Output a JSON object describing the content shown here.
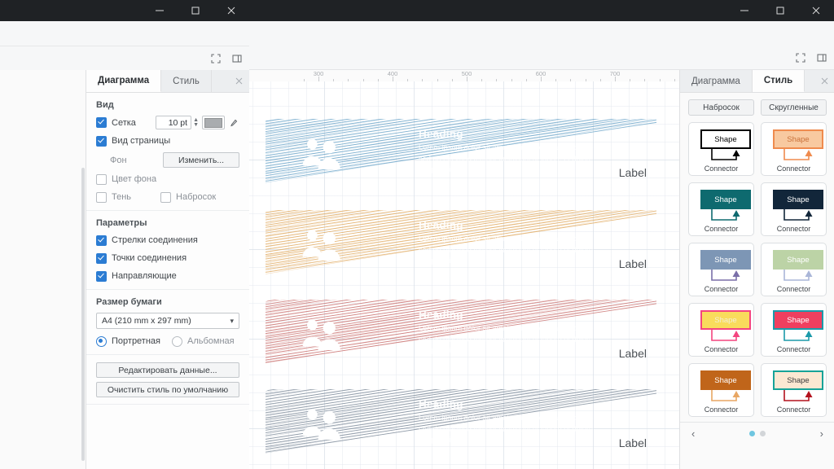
{
  "left_window": {
    "window_buttons": {
      "minimize": "─",
      "maximize": "☐",
      "close": "✕"
    },
    "toolbar_icons": [
      {
        "name": "fullscreen-icon",
        "glyph": "⛶"
      },
      {
        "name": "panel-toggle-icon",
        "glyph": "◧"
      }
    ],
    "panel": {
      "tabs": [
        {
          "label": "Диаграмма",
          "active": true
        },
        {
          "label": "Стиль",
          "active": false
        }
      ],
      "close_glyph": "✕",
      "view_section": {
        "title": "Вид",
        "grid": {
          "label": "Сетка",
          "checked": true,
          "size_value": "10 pt",
          "color": "#a9acaf"
        },
        "page_view": {
          "label": "Вид страницы",
          "checked": true
        },
        "background": {
          "label": "Фон",
          "button": "Изменить..."
        },
        "background_color": {
          "label": "Цвет фона",
          "checked": false
        },
        "shadow": {
          "label": "Тень",
          "checked": false
        },
        "sketch": {
          "label": "Набросок",
          "checked": false
        }
      },
      "options_section": {
        "title": "Параметры",
        "items": [
          {
            "label": "Стрелки соединения",
            "checked": true
          },
          {
            "label": "Точки соединения",
            "checked": true
          },
          {
            "label": "Направляющие",
            "checked": true
          }
        ]
      },
      "paper_section": {
        "title": "Размер бумаги",
        "size_value": "A4 (210 mm x 297 mm)",
        "chevron": "⌄",
        "orientation": [
          {
            "label": "Портретная",
            "selected": true
          },
          {
            "label": "Альбомная",
            "selected": false
          }
        ]
      },
      "actions": [
        "Редактировать данные...",
        "Очистить стиль по умолчанию"
      ]
    }
  },
  "right_window": {
    "window_buttons": {
      "minimize": "─",
      "maximize": "☐",
      "close": "✕"
    },
    "toolbar_icons": [
      {
        "name": "fullscreen-icon",
        "glyph": "⛶"
      },
      {
        "name": "panel-toggle-icon",
        "glyph": "◧"
      }
    ],
    "ruler": {
      "numbers": [
        "300",
        "400",
        "500",
        "600",
        "700"
      ],
      "unit_step": 100
    },
    "canvas": {
      "bands": [
        {
          "color": "#6aa4c8",
          "heading": "Heading",
          "lorem": "Lorem ipsum dolor sit amet, consectetur adipiscing elit, sed do eiusmod tempor incididunt ut labore et dolore magna aliqua.",
          "label": "Label",
          "icon": "people-icon"
        },
        {
          "color": "#e0a95e",
          "heading": "Heading",
          "lorem": "Lorem ipsum dolor sit amet, consectetur adipiscing elit, sed do eiusmod tempor incididunt ut labore et dolore magna aliqua.",
          "label": "Label",
          "icon": "people-icon"
        },
        {
          "color": "#c9706e",
          "heading": "Heading",
          "lorem": "Lorem ipsum dolor sit amet, consectetur adipiscing elit, sed do eiusmod tempor incididunt ut labore et dolore magna aliqua.",
          "label": "Label",
          "icon": "people-icon"
        },
        {
          "color": "#7d8a99",
          "heading": "Heading",
          "lorem": "Lorem ipsum dolor sit amet, consectetur adipiscing elit, sed do eiusmod tempor incididunt ut labore et dolore magna aliqua.",
          "label": "Label",
          "icon": "people-icon"
        }
      ]
    },
    "style_panel": {
      "tabs": [
        {
          "label": "Диаграмма",
          "active": false
        },
        {
          "label": "Стиль",
          "active": true
        }
      ],
      "close_glyph": "✕",
      "pills": [
        {
          "label": "Набросок"
        },
        {
          "label": "Скругленные"
        }
      ],
      "shape_label": "Shape",
      "connector_label": "Connector",
      "presets": [
        {
          "fill": "#ffffff",
          "stroke": "#000000",
          "text": "#000000",
          "connector": "#000000"
        },
        {
          "fill": "#f8c9a0",
          "stroke": "#ef8b4e",
          "text": "#c9713a",
          "connector": "#ef8b4e"
        },
        {
          "fill": "#0e6a6f",
          "stroke": "#0e6a6f",
          "text": "#ffffff",
          "connector": "#0e6a6f"
        },
        {
          "fill": "#12263a",
          "stroke": "#12263a",
          "text": "#ffffff",
          "connector": "#12263a"
        },
        {
          "fill": "#7d96b5",
          "stroke": "#7d96b5",
          "text": "#ffffff",
          "connector": "#7a6fa8"
        },
        {
          "fill": "#bcd3a6",
          "stroke": "#bcd3a6",
          "text": "#ffffff",
          "connector": "#aab6d8"
        },
        {
          "fill": "#f9dc5c",
          "stroke": "#f4457f",
          "text": "#f3f0d8",
          "connector": "#f4457f"
        },
        {
          "fill": "#ef3f5f",
          "stroke": "#1b9aaa",
          "text": "#ffffff",
          "connector": "#1b9aaa"
        },
        {
          "fill": "#c0651a",
          "stroke": "#c0651a",
          "text": "#ffffff",
          "connector": "#e8a663"
        },
        {
          "fill": "#fbe8d2",
          "stroke": "#17a398",
          "text": "#3a3a3a",
          "connector": "#b3121d"
        }
      ],
      "pager": {
        "prev": "‹",
        "next": "›",
        "dots": 2,
        "active_dot": 0
      }
    }
  }
}
